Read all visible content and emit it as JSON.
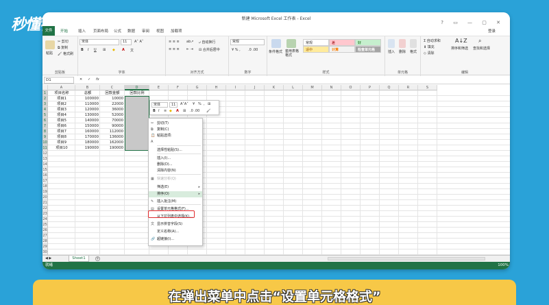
{
  "watermark": "秒懂视频",
  "window": {
    "title": "新建 Microsoft Excel 工作表 - Excel",
    "controls": "? ▭ — ▢ ✕",
    "signin": "登录"
  },
  "tabs": [
    "文件",
    "开始",
    "插入",
    "页面布局",
    "公式",
    "数据",
    "审阅",
    "视图",
    "加载项"
  ],
  "ribbon": {
    "clipboard": {
      "paste": "粘贴",
      "cut": "剪切",
      "copy": "复制",
      "format_painter": "格式刷",
      "label": "剪贴板"
    },
    "font": {
      "name": "宋体",
      "size": "11",
      "label": "字体"
    },
    "alignment": {
      "wrap": "自动换行",
      "merge": "合并后居中",
      "label": "对齐方式"
    },
    "number": {
      "format": "常规",
      "label": "数字"
    },
    "styles": {
      "conditional": "条件格式",
      "table_format": "套用表格格式",
      "cells": [
        "常规",
        "差",
        "好",
        "适中",
        "计算",
        "检查单元格"
      ],
      "label": "样式"
    },
    "cells": {
      "insert": "插入",
      "delete": "删除",
      "format": "格式",
      "label": "单元格"
    },
    "editing": {
      "autosum": "自动求和",
      "fill": "填充",
      "clear": "清除",
      "sort": "排序和筛选",
      "find": "查找和选择",
      "label": "编辑"
    }
  },
  "formula_bar": {
    "name_box": "D1",
    "fx": "fx",
    "cancel": "✕",
    "enter": "✓"
  },
  "columns": [
    "A",
    "B",
    "C",
    "D",
    "E",
    "F",
    "G",
    "H",
    "I",
    "J",
    "K",
    "L",
    "M",
    "N",
    "O",
    "P",
    "Q",
    "R",
    "S"
  ],
  "rows": [
    "1",
    "2",
    "3",
    "4",
    "5",
    "6",
    "7",
    "8",
    "9",
    "10",
    "11",
    "12",
    "13",
    "14",
    "15",
    "16",
    "17",
    "18",
    "19",
    "20",
    "21",
    "22",
    "23",
    "24",
    "25",
    "26",
    "27",
    "28",
    "29",
    "30"
  ],
  "sheet": {
    "headers": [
      "项目名称",
      "总额",
      "回款金额",
      "回款比例"
    ],
    "data": [
      [
        "项目1",
        "100000",
        "10000"
      ],
      [
        "项目2",
        "110000",
        "22000"
      ],
      [
        "项目3",
        "120000",
        "36000"
      ],
      [
        "项目4",
        "130000",
        "52000"
      ],
      [
        "项目5",
        "140000",
        "70000"
      ],
      [
        "项目6",
        "150000",
        "90000"
      ],
      [
        "项目7",
        "160000",
        "112000"
      ],
      [
        "项目8",
        "170000",
        "136000"
      ],
      [
        "项目9",
        "180000",
        "162000"
      ],
      [
        "项目10",
        "190000",
        "190000"
      ]
    ]
  },
  "mini_toolbar": {
    "font": "宋体",
    "size": "11",
    "percent": "%",
    "comma": ","
  },
  "context_menu": [
    {
      "label": "剪切(T)",
      "icon": "✂"
    },
    {
      "label": "复制(C)",
      "icon": "⧉"
    },
    {
      "label": "粘贴选项:",
      "icon": "📋"
    },
    {
      "label": "",
      "icon": "A"
    },
    {
      "label": "选择性粘贴(S)...",
      "icon": ""
    },
    {
      "label": "插入(I)...",
      "icon": ""
    },
    {
      "label": "删除(D)...",
      "icon": ""
    },
    {
      "label": "清除内容(N)",
      "icon": ""
    },
    {
      "label": "快速分析(Q)",
      "icon": "▦"
    },
    {
      "label": "筛选(E)",
      "icon": ""
    },
    {
      "label": "排序(O)",
      "icon": ""
    },
    {
      "label": "插入批注(M)",
      "icon": "✎"
    },
    {
      "label": "设置单元格格式(F)...",
      "icon": "▤"
    },
    {
      "label": "从下拉列表中选择(K)...",
      "icon": ""
    },
    {
      "label": "显示拼音字段(S)",
      "icon": "文"
    },
    {
      "label": "定义名称(A)...",
      "icon": ""
    },
    {
      "label": "超链接(I)...",
      "icon": "🔗"
    }
  ],
  "sheet_tab": "Sheet1",
  "status": {
    "ready": "就绪",
    "zoom": "100%"
  },
  "caption": "在弹出菜单中点击“设置单元格格式”",
  "colors": {
    "excel_green": "#217346",
    "background": "#2aa2d8",
    "caption_bg": "#f7c847",
    "highlight": "#e0282b"
  }
}
